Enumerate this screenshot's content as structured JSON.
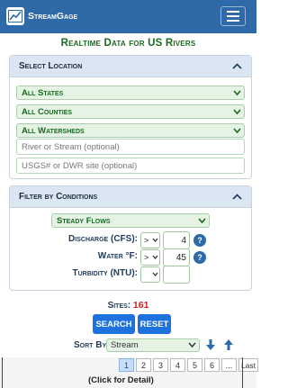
{
  "navbar": {
    "brand": "StreamGage",
    "menu_icon": "hamburger-icon",
    "color": "#2e6aa8"
  },
  "page_title": "Realtime Data for US Rivers",
  "location": {
    "title": "Select Location",
    "states": "All States",
    "counties": "All Counties",
    "watersheds": "All Watersheds",
    "river_placeholder": "River or Stream (optional)",
    "site_placeholder": "USGS# or DWR site (optional)"
  },
  "conditions": {
    "title": "Filter by Conditions",
    "flow_type": "Steady Flows",
    "rows": [
      {
        "label": "Discharge (CFS):",
        "op": ">",
        "value": "4"
      },
      {
        "label": "Water °F:",
        "op": ">",
        "value": "45"
      },
      {
        "label": "Turbidity (NTU):",
        "op": "",
        "value": ""
      }
    ]
  },
  "sites": {
    "label": "Sites:",
    "count": "161"
  },
  "buttons": {
    "search": "SEARCH",
    "reset": "RESET"
  },
  "sort": {
    "label": "Sort By:",
    "value": "Stream"
  },
  "pager": {
    "pages": [
      "1",
      "2",
      "3",
      "4",
      "5",
      "6",
      "...",
      "Last"
    ],
    "active": "1"
  },
  "table": {
    "detail_hint": "(Click for Detail)"
  },
  "colors": {
    "accent": "#2e6aa8",
    "green": "#176b1e",
    "button": "#1d72dd",
    "count": "#cc1f1f"
  }
}
